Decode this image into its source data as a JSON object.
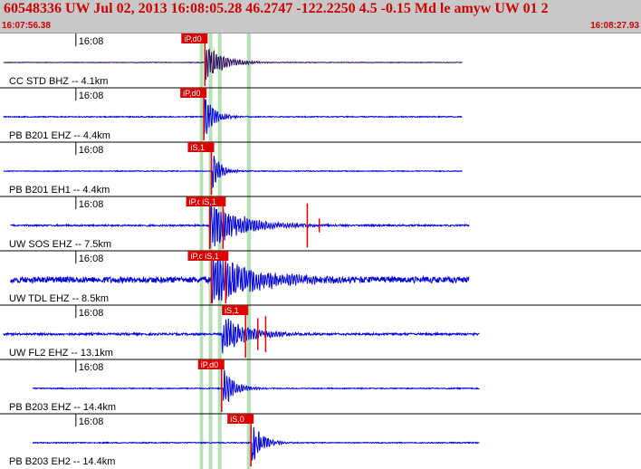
{
  "header": {
    "title": "60548336 UW Jul 02, 2013 16:08:05.28   46.2747 -122.2250  4.5 -0.15 Md le amyw UW 01   2",
    "start_time": "16:07:56.38",
    "end_time": "16:08:27.93"
  },
  "colors": {
    "header_bg": "#c8c8c8",
    "header_text": "#cc0000",
    "trace_primary": "#2a0a5a",
    "trace": "#0000dd",
    "pick_box": "#dd0000",
    "pick_text": "#ffffff",
    "window": "#b8e0b8",
    "ink": "#000000"
  },
  "windows_sec": [
    [
      58,
      59
    ],
    [
      60.6,
      61.7
    ],
    [
      63.3,
      64.4
    ],
    [
      71.8,
      73.0
    ]
  ],
  "traces": [
    {
      "label": "CC STD BHZ -- 4.1km",
      "time_label": "16:08",
      "primary": true,
      "pick_labels": [
        "iP,d0"
      ],
      "picks": [
        59.5
      ],
      "onset": 59.5,
      "amp": 0.8,
      "noise": 0.03,
      "decay": 5,
      "end": 135,
      "spikes": []
    },
    {
      "label": "PB B201 EHZ -- 4.4km",
      "time_label": "16:08",
      "pick_labels": [
        "iP,d0"
      ],
      "picks": [
        59.2
      ],
      "onset": 59.2,
      "amp": 0.9,
      "noise": 0.05,
      "decay": 3,
      "end": 135,
      "spikes": []
    },
    {
      "label": "PB B201 EH1 -- 4.4km",
      "time_label": "16:08",
      "pick_labels": [
        "iS,1"
      ],
      "picks": [
        61.4
      ],
      "onset": 61.7,
      "amp": 0.75,
      "noise": 0.04,
      "decay": 2.5,
      "end": 135,
      "spikes": []
    },
    {
      "label": "UW SOS EHZ -- 7.5km",
      "time_label": "16:08",
      "pick_labels": [
        "iP,d0",
        "iS,1"
      ],
      "picks": [
        60.9,
        64.8
      ],
      "onset": 60.9,
      "amp": 1.0,
      "noise": 0.08,
      "decay": 9,
      "end": 137,
      "spikes": [
        [
          89.5,
          1.1
        ],
        [
          93,
          0.35
        ]
      ]
    },
    {
      "label": "UW TDL EHZ -- 8.5km",
      "time_label": "16:08",
      "pick_labels": [
        "iP,d0",
        "iS,1"
      ],
      "picks": [
        61.4,
        65.6
      ],
      "onset": 61.4,
      "amp": 1.1,
      "noise": 0.3,
      "decay": 12,
      "end": 137,
      "spikes": []
    },
    {
      "label": "UW FL2 EHZ -- 13.1km",
      "time_label": "16:08",
      "pick_labels": [
        "iS,1"
      ],
      "picks": [
        71.4
      ],
      "onset": 64.5,
      "amp": 0.8,
      "noise": 0.1,
      "decay": 8,
      "end": 140,
      "spikes": [
        [
          75,
          0.8
        ],
        [
          77.3,
          0.9
        ]
      ]
    },
    {
      "label": "PB B203 EHZ -- 14.4km",
      "time_label": "16:08",
      "pick_labels": [
        "iP,d0"
      ],
      "picks": [
        64.4
      ],
      "onset": 64.8,
      "amp": 1.0,
      "noise": 0.05,
      "decay": 3,
      "end": 140,
      "spikes": []
    },
    {
      "label": "PB B203 EH2 -- 14.4km",
      "time_label": "16:08",
      "pick_labels": [
        "iS,0"
      ],
      "picks": [
        73.0
      ],
      "onset": 73.3,
      "amp": 0.9,
      "noise": 0.05,
      "decay": 3,
      "end": 140,
      "spikes": []
    }
  ]
}
